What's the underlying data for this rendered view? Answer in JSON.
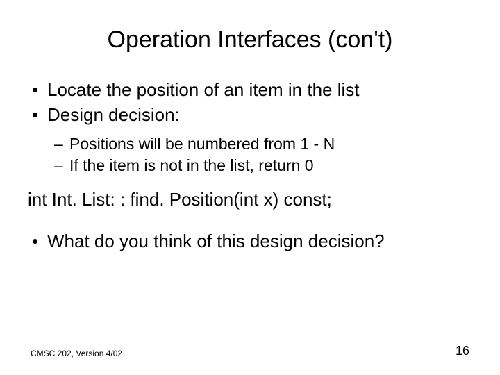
{
  "slide": {
    "title": "Operation Interfaces (con't)",
    "bullets": {
      "b1": "Locate the position of an item in the list",
      "b2": "Design decision:",
      "b3": "What do you think of this design decision?"
    },
    "subbullets": {
      "s1": "Positions will be numbered from 1 - N",
      "s2": "If the item is not in the list, return 0"
    },
    "code": "int Int. List: : find. Position(int x) const;",
    "footer_left": "CMSC 202, Version 4/02",
    "footer_right": "16"
  }
}
